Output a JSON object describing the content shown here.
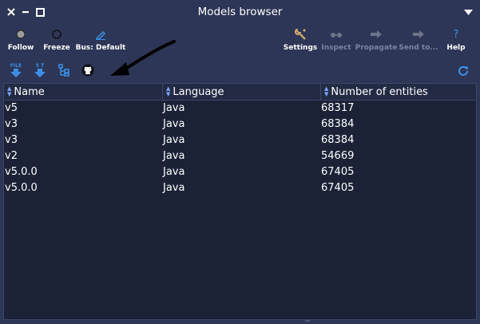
{
  "window": {
    "title": "Models browser"
  },
  "toolbar": {
    "follow": "Follow",
    "freeze": "Freeze",
    "bus": "Bus: Default",
    "settings": "Settings",
    "inspect": "Inspect",
    "propagate": "Propagate",
    "send_to": "Send to...",
    "help": "Help"
  },
  "secondary_toolbar": {
    "file_export_label": "FILE",
    "st_export_label": "S T"
  },
  "table": {
    "columns": [
      "Name",
      "Language",
      "Number of entities"
    ],
    "rows": [
      [
        "v5",
        "Java",
        "68317"
      ],
      [
        "v3",
        "Java",
        "68384"
      ],
      [
        "v3",
        "Java",
        "68384"
      ],
      [
        "v2",
        "Java",
        "54669"
      ],
      [
        "v5.0.0",
        "Java",
        "67405"
      ],
      [
        "v5.0.0",
        "Java",
        "67405"
      ]
    ]
  },
  "colors": {
    "background": "#2d3656",
    "table_background": "#1b2236",
    "accent_blue": "#3d8fe8",
    "disabled": "#7c84a2"
  }
}
